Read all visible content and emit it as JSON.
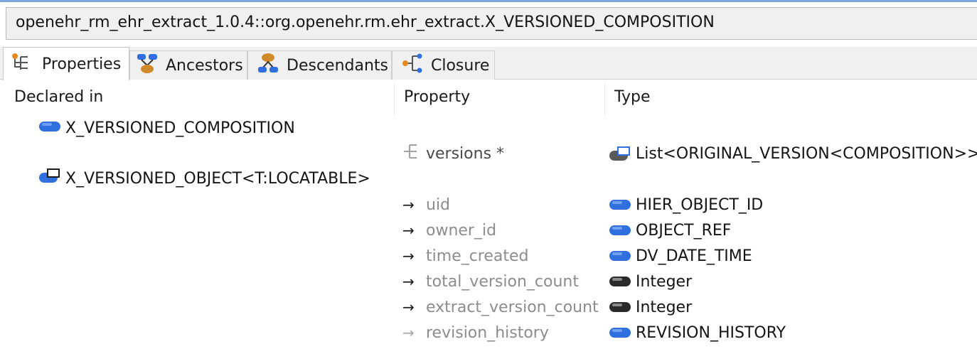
{
  "window": {
    "title": "openehr_rm_ehr_extract_1.0.4::org.openehr.rm.ehr_extract.X_VERSIONED_COMPOSITION"
  },
  "tabs": [
    {
      "label": "Properties",
      "icon": "property-tree-icon",
      "active": true
    },
    {
      "label": "Ancestors",
      "icon": "ancestors-icon",
      "active": false
    },
    {
      "label": "Descendants",
      "icon": "descendants-icon",
      "active": false
    },
    {
      "label": "Closure",
      "icon": "closure-icon",
      "active": false
    }
  ],
  "columns": {
    "declared_in": "Declared in",
    "property": "Property",
    "type": "Type"
  },
  "declared_in": [
    {
      "label": "X_VERSIONED_COMPOSITION",
      "icon": "class-icon"
    },
    {
      "label": "X_VERSIONED_OBJECT<T:LOCATABLE>",
      "icon": "generic-class-icon"
    }
  ],
  "properties": [
    {
      "name": "versions *",
      "marker": "container-icon",
      "type": "List<ORIGINAL_VERSION<COMPOSITION>>",
      "type_icon": "generic-type-icon"
    },
    {
      "name": "uid",
      "marker": "→",
      "type": "HIER_OBJECT_ID",
      "type_icon": "class-icon"
    },
    {
      "name": "owner_id",
      "marker": "→",
      "type": "OBJECT_REF",
      "type_icon": "class-icon"
    },
    {
      "name": "time_created",
      "marker": "→",
      "type": "DV_DATE_TIME",
      "type_icon": "class-icon"
    },
    {
      "name": "total_version_count",
      "marker": "→",
      "type": "Integer",
      "type_icon": "primitive-icon"
    },
    {
      "name": "extract_version_count",
      "marker": "→",
      "type": "Integer",
      "type_icon": "primitive-icon"
    },
    {
      "name": "revision_history",
      "marker": "→",
      "type": "REVISION_HISTORY",
      "type_icon": "class-icon"
    }
  ],
  "colors": {
    "class_blue": "#2f6fe0",
    "primitive_grey": "#3a3a3a",
    "tab_bg": "#f0f0f0",
    "accent": "#7aa7d6"
  }
}
